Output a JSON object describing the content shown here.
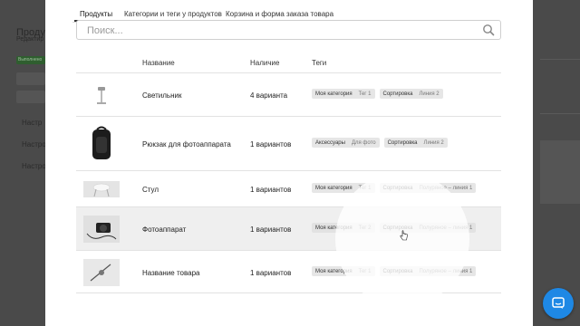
{
  "background": {
    "title": "Продукц",
    "subtitle": "Редактир",
    "badge": "Выполнено",
    "nav": [
      "Настр",
      "Настро",
      "Настро"
    ]
  },
  "tabs": [
    {
      "label": "Продукты",
      "active": true
    },
    {
      "label": "Категории и теги у продуктов",
      "active": false
    },
    {
      "label": "Корзина и форма заказа товара",
      "active": false
    }
  ],
  "search": {
    "placeholder": "Поиск..."
  },
  "table": {
    "headers": {
      "name": "Название",
      "stock": "Наличие",
      "tags": "Теги"
    },
    "rows": [
      {
        "thumb": "lamp-image",
        "name": "Светильник",
        "stock": "4 варианта",
        "highlighted": false,
        "tags": [
          {
            "k": "Моя категория",
            "v": "Тег 1"
          },
          {
            "k": "Сортировка",
            "v": "Линия 2"
          }
        ]
      },
      {
        "thumb": "backpack-image",
        "name": "Рюкзак для фотоаппарата",
        "stock": "1 вариантов",
        "highlighted": false,
        "tags": [
          {
            "k": "Аксессуары",
            "v": "Для фото"
          },
          {
            "k": "Сортировка",
            "v": "Линия 2"
          }
        ]
      },
      {
        "thumb": "chair-image",
        "name": "Стул",
        "stock": "1 вариантов",
        "highlighted": false,
        "tags": [
          {
            "k": "Моя категория",
            "v": "Тег 1"
          },
          {
            "k": "Сортировка",
            "v": "Полуряное – линия 1"
          }
        ]
      },
      {
        "thumb": "camera-image",
        "name": "Фотоаппарат",
        "stock": "1 вариантов",
        "highlighted": true,
        "tags": [
          {
            "k": "Моя категория",
            "v": "Тег 2"
          },
          {
            "k": "Сортировка",
            "v": "Полуряное – линия 1"
          }
        ]
      },
      {
        "thumb": "product-image",
        "name": "Название товара",
        "stock": "1 вариантов",
        "highlighted": false,
        "tags": [
          {
            "k": "Моя категория",
            "v": "Тег 1"
          },
          {
            "k": "Сортировка",
            "v": "Полуряное – линия 1"
          }
        ]
      }
    ]
  },
  "colors": {
    "chat_button": "#1e88e5",
    "modal_bg": "#ffffff",
    "overlay": "#3c3c3c"
  },
  "icons": {
    "search": "search-icon",
    "chat": "chat-icon",
    "cursor": "hand-cursor-icon"
  }
}
